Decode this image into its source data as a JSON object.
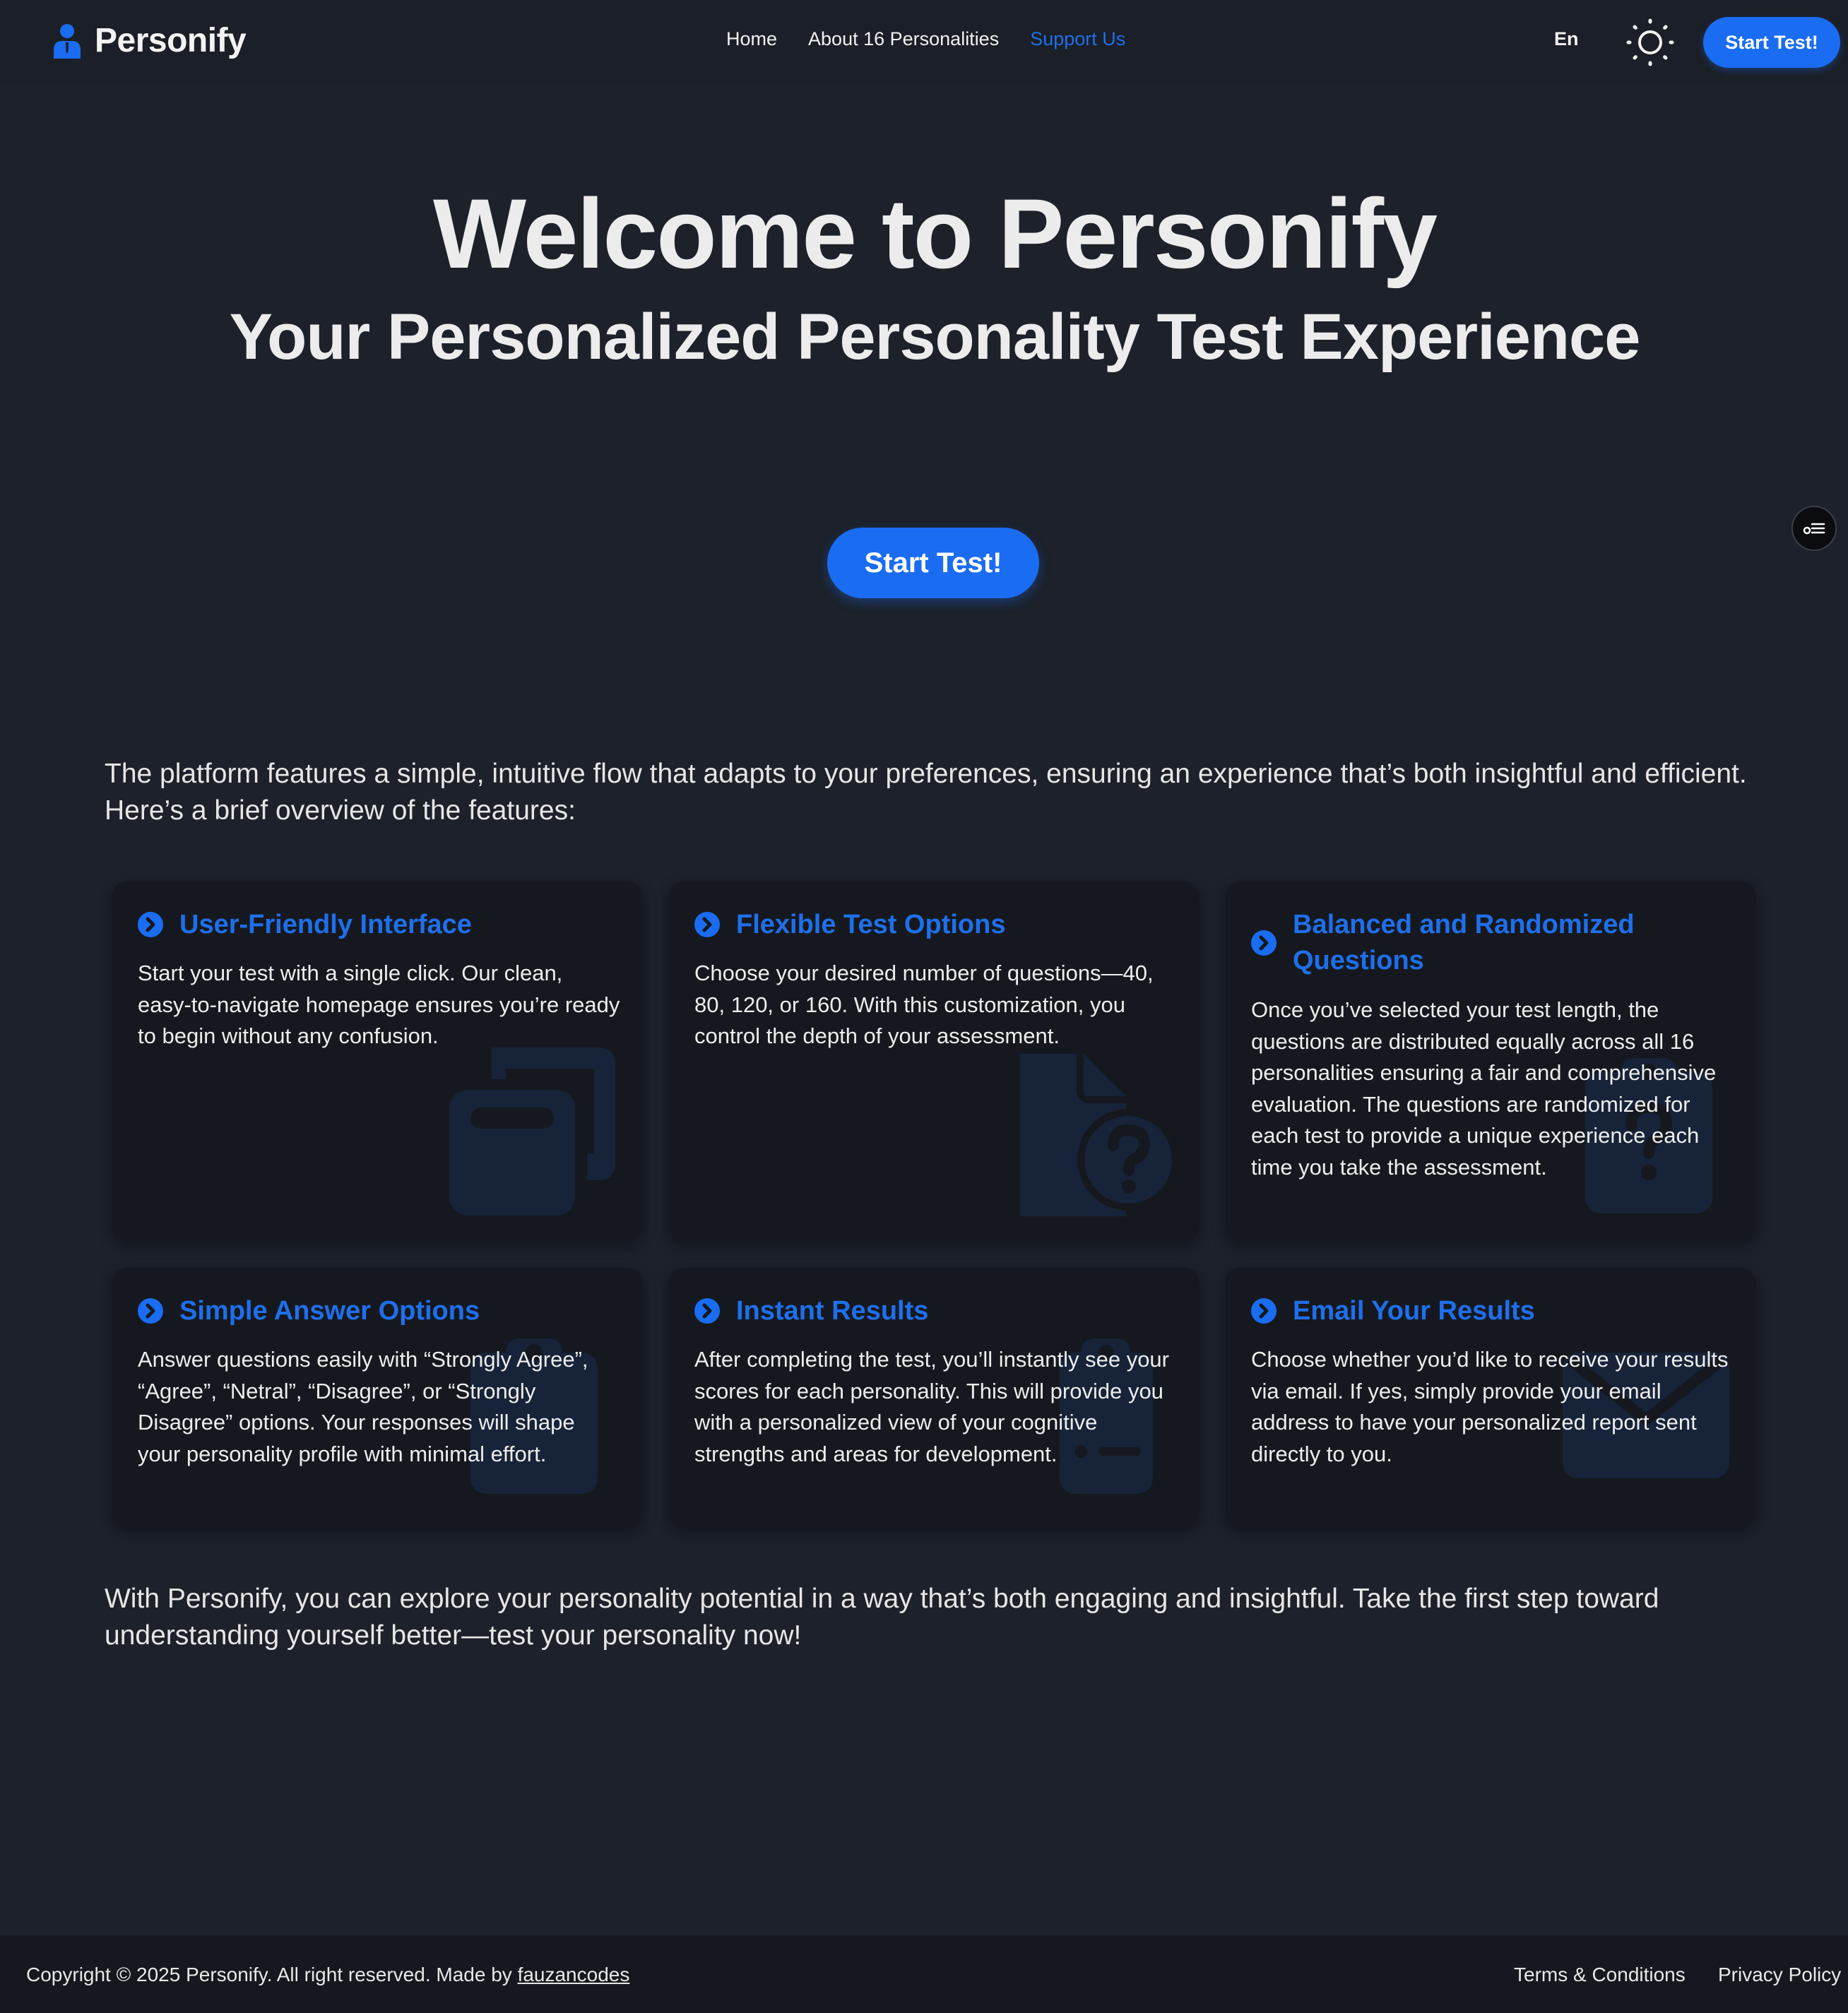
{
  "brand": {
    "name": "Personify",
    "icon": "user-icon",
    "accent": "#1a6cf2"
  },
  "nav": {
    "links": [
      {
        "label": "Home",
        "active": false
      },
      {
        "label": "About 16 Personalities",
        "active": false
      },
      {
        "label": "Support Us",
        "active": true
      }
    ],
    "language": "En",
    "theme_icon": "sun-icon",
    "cta_label": "Start Test!"
  },
  "hero": {
    "title": "Welcome to Personify",
    "subtitle": "Your Personalized Personality Test Experience",
    "cta_label": "Start Test!"
  },
  "side_widget": {
    "icon": "settings-sliders-icon"
  },
  "intro": "The platform features a simple, intuitive flow that adapts to your preferences, ensuring an experience that’s both insightful and efficient. Here’s a brief overview of the features:",
  "features": [
    {
      "title": "User-Friendly Interface",
      "body": "Start your test with a single click. Our clean, easy-to-navigate homepage ensures you’re ready to begin without any confusion.",
      "bg_icon": "copy-icon"
    },
    {
      "title": "Flexible Test Options",
      "body": "Choose your desired number of questions—40, 80, 120, or 160. With this customization, you control the depth of your assessment.",
      "bg_icon": "file-question-icon"
    },
    {
      "title": "Balanced and Randomized Questions",
      "body": "Once you’ve selected your test length, the questions are distributed equally across all 16 personalities ensuring a fair and comprehensive evaluation. The questions are randomized for each test to provide a unique experience each time you take the assessment.",
      "bg_icon": "clipboard-question-icon"
    },
    {
      "title": "Simple Answer Options",
      "body": "Answer questions easily with “Strongly Agree”, “Agree”, “Netral”, “Disagree”, or “Strongly Disagree” options. Your responses will shape your personality profile with minimal effort.",
      "bg_icon": "clipboard-icon"
    },
    {
      "title": "Instant Results",
      "body": "After completing the test, you’ll instantly see your scores for each personality. This will provide you with a personalized view of your cognitive strengths and areas for development.",
      "bg_icon": "clipboard-list-icon"
    },
    {
      "title": "Email Your Results",
      "body": "Choose whether you’d like to receive your results via email. If yes, simply provide your email address to have your personalized report sent directly to you.",
      "bg_icon": "envelope-icon"
    }
  ],
  "outro": "With Personify, you can explore your personality potential in a way that’s both engaging and insightful. Take the first step toward understanding yourself better—test your personality now!",
  "footer": {
    "copyright": "Copyright © 2025 Personify. All right reserved. Made by ",
    "author": "fauzancodes",
    "terms": "Terms & Conditions",
    "privacy": "Privacy Policy"
  }
}
